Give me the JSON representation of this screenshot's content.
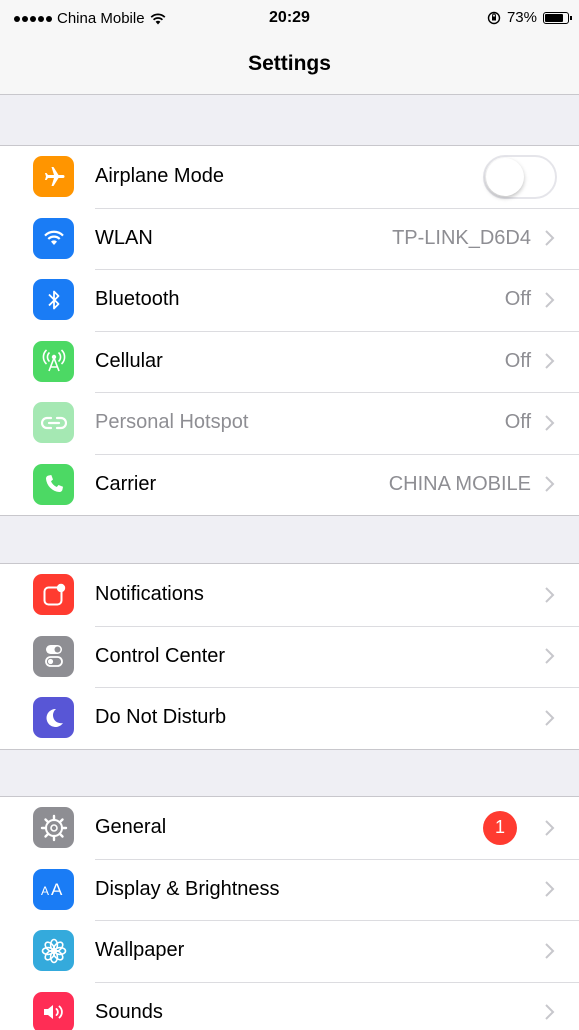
{
  "status_bar": {
    "carrier": "China Mobile",
    "time": "20:29",
    "battery": "73%",
    "battery_level": 0.73
  },
  "nav": {
    "title": "Settings"
  },
  "groups": [
    {
      "rows": [
        {
          "label": "Airplane Mode",
          "icon": "airplane-icon",
          "color": "#ff9500",
          "control": "toggle",
          "toggle_on": false
        },
        {
          "label": "WLAN",
          "icon": "wifi-icon",
          "color": "#1a7cf5",
          "value": "TP-LINK_D6D4"
        },
        {
          "label": "Bluetooth",
          "icon": "bluetooth-icon",
          "color": "#1a7cf5",
          "value": "Off"
        },
        {
          "label": "Cellular",
          "icon": "cellular-icon",
          "color": "#4cd964",
          "value": "Off"
        },
        {
          "label": "Personal Hotspot",
          "icon": "hotspot-icon",
          "color": "#a5e8b3",
          "value": "Off",
          "disabled": true
        },
        {
          "label": "Carrier",
          "icon": "phone-icon",
          "color": "#4cd964",
          "value": "CHINA MOBILE"
        }
      ]
    },
    {
      "rows": [
        {
          "label": "Notifications",
          "icon": "notifications-icon",
          "color": "#ff3b30"
        },
        {
          "label": "Control Center",
          "icon": "control-center-icon",
          "color": "#8e8e93"
        },
        {
          "label": "Do Not Disturb",
          "icon": "moon-icon",
          "color": "#5856d6"
        }
      ]
    },
    {
      "rows": [
        {
          "label": "General",
          "icon": "gear-icon",
          "color": "#8e8e93",
          "badge": "1"
        },
        {
          "label": "Display & Brightness",
          "icon": "display-icon",
          "color": "#1a7cf5"
        },
        {
          "label": "Wallpaper",
          "icon": "wallpaper-icon",
          "color": "#34aadc"
        },
        {
          "label": "Sounds",
          "icon": "speaker-icon",
          "color": "#ff2d55"
        }
      ]
    }
  ]
}
